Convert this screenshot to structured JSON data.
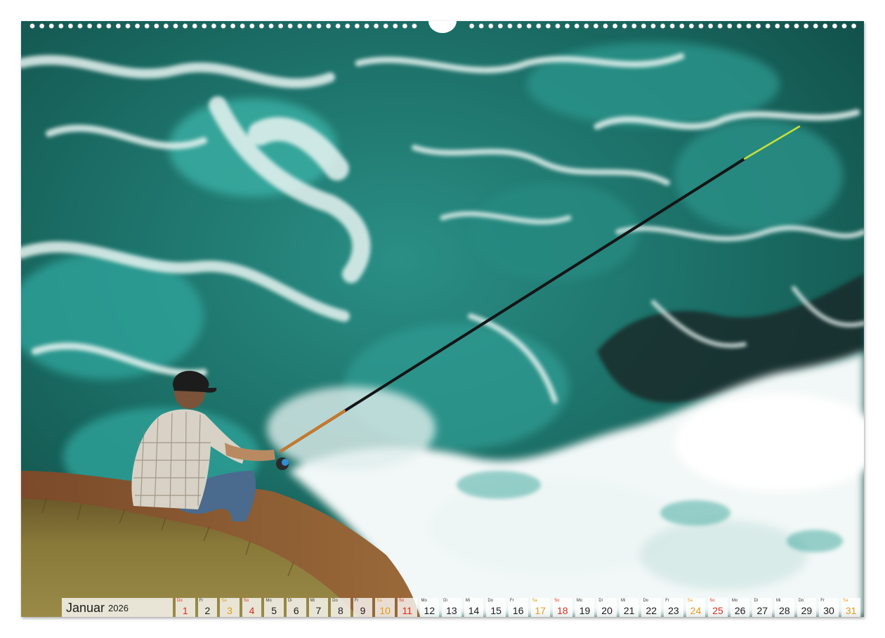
{
  "calendar": {
    "month": "Januar",
    "year": "2026",
    "days": [
      {
        "dow": "Do",
        "num": "1",
        "type": "holiday"
      },
      {
        "dow": "Fr",
        "num": "2",
        "type": "weekday"
      },
      {
        "dow": "Sa",
        "num": "3",
        "type": "sat"
      },
      {
        "dow": "So",
        "num": "4",
        "type": "sun"
      },
      {
        "dow": "Mo",
        "num": "5",
        "type": "weekday"
      },
      {
        "dow": "Di",
        "num": "6",
        "type": "weekday"
      },
      {
        "dow": "Mi",
        "num": "7",
        "type": "weekday"
      },
      {
        "dow": "Do",
        "num": "8",
        "type": "weekday"
      },
      {
        "dow": "Fr",
        "num": "9",
        "type": "weekday"
      },
      {
        "dow": "Sa",
        "num": "10",
        "type": "sat"
      },
      {
        "dow": "So",
        "num": "11",
        "type": "sun"
      },
      {
        "dow": "Mo",
        "num": "12",
        "type": "weekday"
      },
      {
        "dow": "Di",
        "num": "13",
        "type": "weekday"
      },
      {
        "dow": "Mi",
        "num": "14",
        "type": "weekday"
      },
      {
        "dow": "Do",
        "num": "15",
        "type": "weekday"
      },
      {
        "dow": "Fr",
        "num": "16",
        "type": "weekday"
      },
      {
        "dow": "Sa",
        "num": "17",
        "type": "sat"
      },
      {
        "dow": "So",
        "num": "18",
        "type": "sun"
      },
      {
        "dow": "Mo",
        "num": "19",
        "type": "weekday"
      },
      {
        "dow": "Di",
        "num": "20",
        "type": "weekday"
      },
      {
        "dow": "Mi",
        "num": "21",
        "type": "weekday"
      },
      {
        "dow": "Do",
        "num": "22",
        "type": "weekday"
      },
      {
        "dow": "Fr",
        "num": "23",
        "type": "weekday"
      },
      {
        "dow": "Sa",
        "num": "24",
        "type": "sat"
      },
      {
        "dow": "So",
        "num": "25",
        "type": "sun"
      },
      {
        "dow": "Mo",
        "num": "26",
        "type": "weekday"
      },
      {
        "dow": "Di",
        "num": "27",
        "type": "weekday"
      },
      {
        "dow": "Mi",
        "num": "28",
        "type": "weekday"
      },
      {
        "dow": "Do",
        "num": "29",
        "type": "weekday"
      },
      {
        "dow": "Fr",
        "num": "30",
        "type": "weekday"
      },
      {
        "dow": "Sa",
        "num": "31",
        "type": "sat"
      }
    ]
  },
  "colors": {
    "saturday": "#e69a1a",
    "sunday_holiday": "#d62d20",
    "sea_dark": "#14574f",
    "sea_light": "#2fa39a",
    "foam": "#e8f4f2",
    "grass": "#7a6a2e"
  }
}
